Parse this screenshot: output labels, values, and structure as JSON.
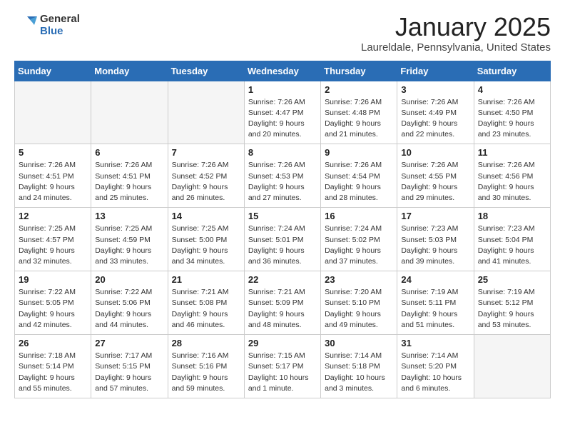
{
  "header": {
    "logo_line1": "General",
    "logo_line2": "Blue",
    "month": "January 2025",
    "location": "Laureldale, Pennsylvania, United States"
  },
  "weekdays": [
    "Sunday",
    "Monday",
    "Tuesday",
    "Wednesday",
    "Thursday",
    "Friday",
    "Saturday"
  ],
  "weeks": [
    [
      {
        "day": "",
        "sunrise": "",
        "sunset": "",
        "daylight": ""
      },
      {
        "day": "",
        "sunrise": "",
        "sunset": "",
        "daylight": ""
      },
      {
        "day": "",
        "sunrise": "",
        "sunset": "",
        "daylight": ""
      },
      {
        "day": "1",
        "sunrise": "Sunrise: 7:26 AM",
        "sunset": "Sunset: 4:47 PM",
        "daylight": "Daylight: 9 hours and 20 minutes."
      },
      {
        "day": "2",
        "sunrise": "Sunrise: 7:26 AM",
        "sunset": "Sunset: 4:48 PM",
        "daylight": "Daylight: 9 hours and 21 minutes."
      },
      {
        "day": "3",
        "sunrise": "Sunrise: 7:26 AM",
        "sunset": "Sunset: 4:49 PM",
        "daylight": "Daylight: 9 hours and 22 minutes."
      },
      {
        "day": "4",
        "sunrise": "Sunrise: 7:26 AM",
        "sunset": "Sunset: 4:50 PM",
        "daylight": "Daylight: 9 hours and 23 minutes."
      }
    ],
    [
      {
        "day": "5",
        "sunrise": "Sunrise: 7:26 AM",
        "sunset": "Sunset: 4:51 PM",
        "daylight": "Daylight: 9 hours and 24 minutes."
      },
      {
        "day": "6",
        "sunrise": "Sunrise: 7:26 AM",
        "sunset": "Sunset: 4:51 PM",
        "daylight": "Daylight: 9 hours and 25 minutes."
      },
      {
        "day": "7",
        "sunrise": "Sunrise: 7:26 AM",
        "sunset": "Sunset: 4:52 PM",
        "daylight": "Daylight: 9 hours and 26 minutes."
      },
      {
        "day": "8",
        "sunrise": "Sunrise: 7:26 AM",
        "sunset": "Sunset: 4:53 PM",
        "daylight": "Daylight: 9 hours and 27 minutes."
      },
      {
        "day": "9",
        "sunrise": "Sunrise: 7:26 AM",
        "sunset": "Sunset: 4:54 PM",
        "daylight": "Daylight: 9 hours and 28 minutes."
      },
      {
        "day": "10",
        "sunrise": "Sunrise: 7:26 AM",
        "sunset": "Sunset: 4:55 PM",
        "daylight": "Daylight: 9 hours and 29 minutes."
      },
      {
        "day": "11",
        "sunrise": "Sunrise: 7:26 AM",
        "sunset": "Sunset: 4:56 PM",
        "daylight": "Daylight: 9 hours and 30 minutes."
      }
    ],
    [
      {
        "day": "12",
        "sunrise": "Sunrise: 7:25 AM",
        "sunset": "Sunset: 4:57 PM",
        "daylight": "Daylight: 9 hours and 32 minutes."
      },
      {
        "day": "13",
        "sunrise": "Sunrise: 7:25 AM",
        "sunset": "Sunset: 4:59 PM",
        "daylight": "Daylight: 9 hours and 33 minutes."
      },
      {
        "day": "14",
        "sunrise": "Sunrise: 7:25 AM",
        "sunset": "Sunset: 5:00 PM",
        "daylight": "Daylight: 9 hours and 34 minutes."
      },
      {
        "day": "15",
        "sunrise": "Sunrise: 7:24 AM",
        "sunset": "Sunset: 5:01 PM",
        "daylight": "Daylight: 9 hours and 36 minutes."
      },
      {
        "day": "16",
        "sunrise": "Sunrise: 7:24 AM",
        "sunset": "Sunset: 5:02 PM",
        "daylight": "Daylight: 9 hours and 37 minutes."
      },
      {
        "day": "17",
        "sunrise": "Sunrise: 7:23 AM",
        "sunset": "Sunset: 5:03 PM",
        "daylight": "Daylight: 9 hours and 39 minutes."
      },
      {
        "day": "18",
        "sunrise": "Sunrise: 7:23 AM",
        "sunset": "Sunset: 5:04 PM",
        "daylight": "Daylight: 9 hours and 41 minutes."
      }
    ],
    [
      {
        "day": "19",
        "sunrise": "Sunrise: 7:22 AM",
        "sunset": "Sunset: 5:05 PM",
        "daylight": "Daylight: 9 hours and 42 minutes."
      },
      {
        "day": "20",
        "sunrise": "Sunrise: 7:22 AM",
        "sunset": "Sunset: 5:06 PM",
        "daylight": "Daylight: 9 hours and 44 minutes."
      },
      {
        "day": "21",
        "sunrise": "Sunrise: 7:21 AM",
        "sunset": "Sunset: 5:08 PM",
        "daylight": "Daylight: 9 hours and 46 minutes."
      },
      {
        "day": "22",
        "sunrise": "Sunrise: 7:21 AM",
        "sunset": "Sunset: 5:09 PM",
        "daylight": "Daylight: 9 hours and 48 minutes."
      },
      {
        "day": "23",
        "sunrise": "Sunrise: 7:20 AM",
        "sunset": "Sunset: 5:10 PM",
        "daylight": "Daylight: 9 hours and 49 minutes."
      },
      {
        "day": "24",
        "sunrise": "Sunrise: 7:19 AM",
        "sunset": "Sunset: 5:11 PM",
        "daylight": "Daylight: 9 hours and 51 minutes."
      },
      {
        "day": "25",
        "sunrise": "Sunrise: 7:19 AM",
        "sunset": "Sunset: 5:12 PM",
        "daylight": "Daylight: 9 hours and 53 minutes."
      }
    ],
    [
      {
        "day": "26",
        "sunrise": "Sunrise: 7:18 AM",
        "sunset": "Sunset: 5:14 PM",
        "daylight": "Daylight: 9 hours and 55 minutes."
      },
      {
        "day": "27",
        "sunrise": "Sunrise: 7:17 AM",
        "sunset": "Sunset: 5:15 PM",
        "daylight": "Daylight: 9 hours and 57 minutes."
      },
      {
        "day": "28",
        "sunrise": "Sunrise: 7:16 AM",
        "sunset": "Sunset: 5:16 PM",
        "daylight": "Daylight: 9 hours and 59 minutes."
      },
      {
        "day": "29",
        "sunrise": "Sunrise: 7:15 AM",
        "sunset": "Sunset: 5:17 PM",
        "daylight": "Daylight: 10 hours and 1 minute."
      },
      {
        "day": "30",
        "sunrise": "Sunrise: 7:14 AM",
        "sunset": "Sunset: 5:18 PM",
        "daylight": "Daylight: 10 hours and 3 minutes."
      },
      {
        "day": "31",
        "sunrise": "Sunrise: 7:14 AM",
        "sunset": "Sunset: 5:20 PM",
        "daylight": "Daylight: 10 hours and 6 minutes."
      },
      {
        "day": "",
        "sunrise": "",
        "sunset": "",
        "daylight": ""
      }
    ]
  ]
}
